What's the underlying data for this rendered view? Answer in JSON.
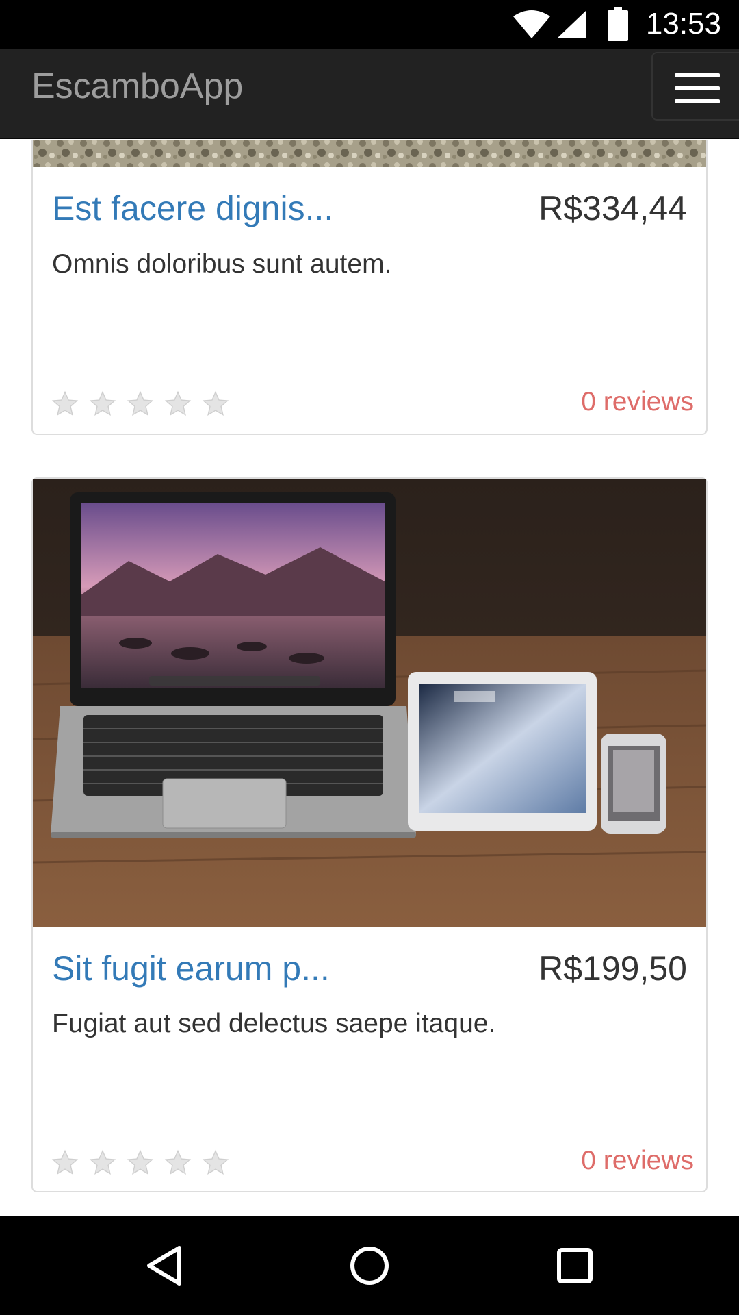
{
  "status_bar": {
    "time": "13:53",
    "icons": [
      "wifi-icon",
      "signal-icon",
      "battery-icon"
    ]
  },
  "header": {
    "brand": "EscamboApp",
    "menu_icon": "hamburger-menu-icon"
  },
  "products": [
    {
      "title": "Est facere dignis...",
      "price": "R$334,44",
      "description": "Omnis doloribus sunt autem.",
      "rating": 0,
      "reviews": "0 reviews",
      "image": "rocky-ground-photo"
    },
    {
      "title": "Sit fugit earum p...",
      "price": "R$199,50",
      "description": "Fugiat aut sed delectus saepe itaque.",
      "rating": 0,
      "reviews": "0 reviews",
      "image": "laptop-tablet-phone-photo"
    }
  ],
  "nav_bar": {
    "back": "back-icon",
    "home": "home-icon",
    "recents": "recents-icon"
  },
  "colors": {
    "navbar_bg": "#222222",
    "brand_text": "#9d9d9d",
    "title_link": "#337ab7",
    "reviews_text": "#d9534f",
    "star_empty": "#dddddd"
  }
}
